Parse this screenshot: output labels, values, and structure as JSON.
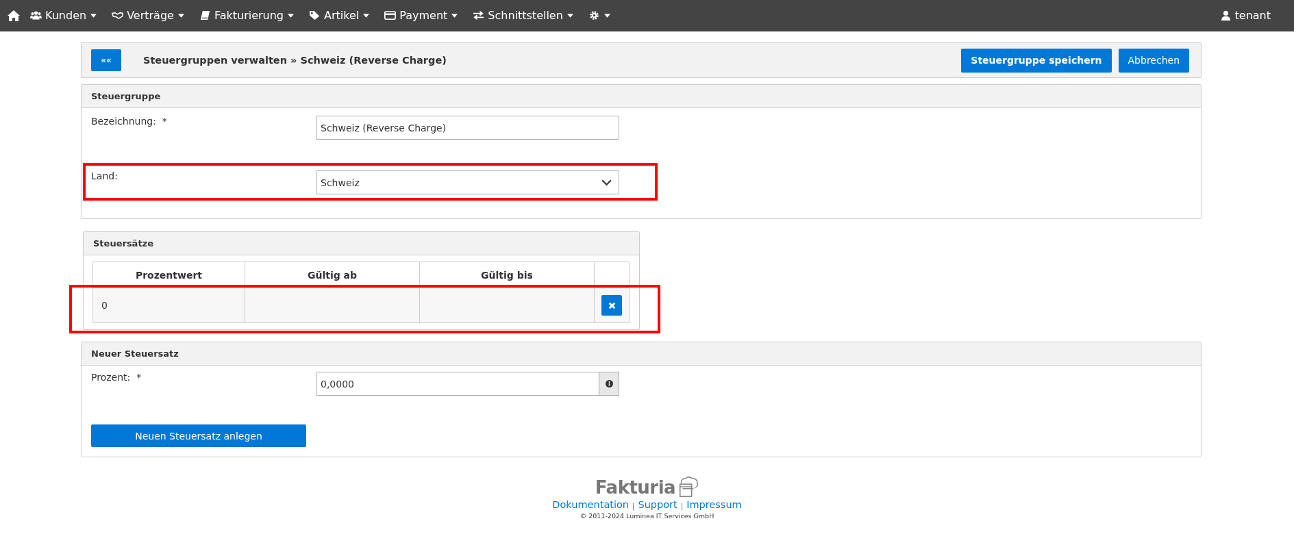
{
  "navbar": {
    "items": [
      {
        "kind": "text",
        "label": "Kunden"
      },
      {
        "kind": "text",
        "label": "Verträge"
      },
      {
        "kind": "text",
        "label": "Fakturierung"
      },
      {
        "kind": "text",
        "label": "Artikel"
      },
      {
        "kind": "text",
        "label": "Payment"
      },
      {
        "kind": "text",
        "label": "Schnittstellen"
      },
      {
        "kind": "icon"
      }
    ],
    "user": "tenant"
  },
  "header": {
    "back_button": "««",
    "title": "Steuergruppen verwalten » Schweiz (Reverse Charge)",
    "buttons": [
      "Steuergruppe speichern",
      "Abbrechen"
    ]
  },
  "steuergruppe": {
    "title": "Steuergruppe",
    "fields": [
      {
        "label": "Bezeichnung:",
        "required_mark": "*",
        "kind": "text",
        "value": "Schweiz (Reverse Charge)",
        "highlighted": false
      },
      {
        "label": "Land:",
        "kind": "select",
        "value": "Schweiz",
        "highlighted": true
      }
    ]
  },
  "steuersaetze": {
    "title": "Steuersätze",
    "columns": [
      "Prozentwert",
      "Gültig ab",
      "Gültig bis"
    ],
    "rows": [
      {
        "cells": [
          "0",
          "",
          ""
        ],
        "highlighted": true
      }
    ]
  },
  "neuer_steuersatz": {
    "title": "Neuer Steuersatz",
    "label": "Prozent:",
    "required_mark": "*",
    "value": "0,0000",
    "button": "Neuen Steuersatz anlegen"
  },
  "footer": {
    "logo": "Fakturia",
    "links": [
      "Dokumentation",
      "Support",
      "Impressum"
    ],
    "separator": "|",
    "copyright": "© 2011-2024 Luminea IT Services GmbH"
  }
}
